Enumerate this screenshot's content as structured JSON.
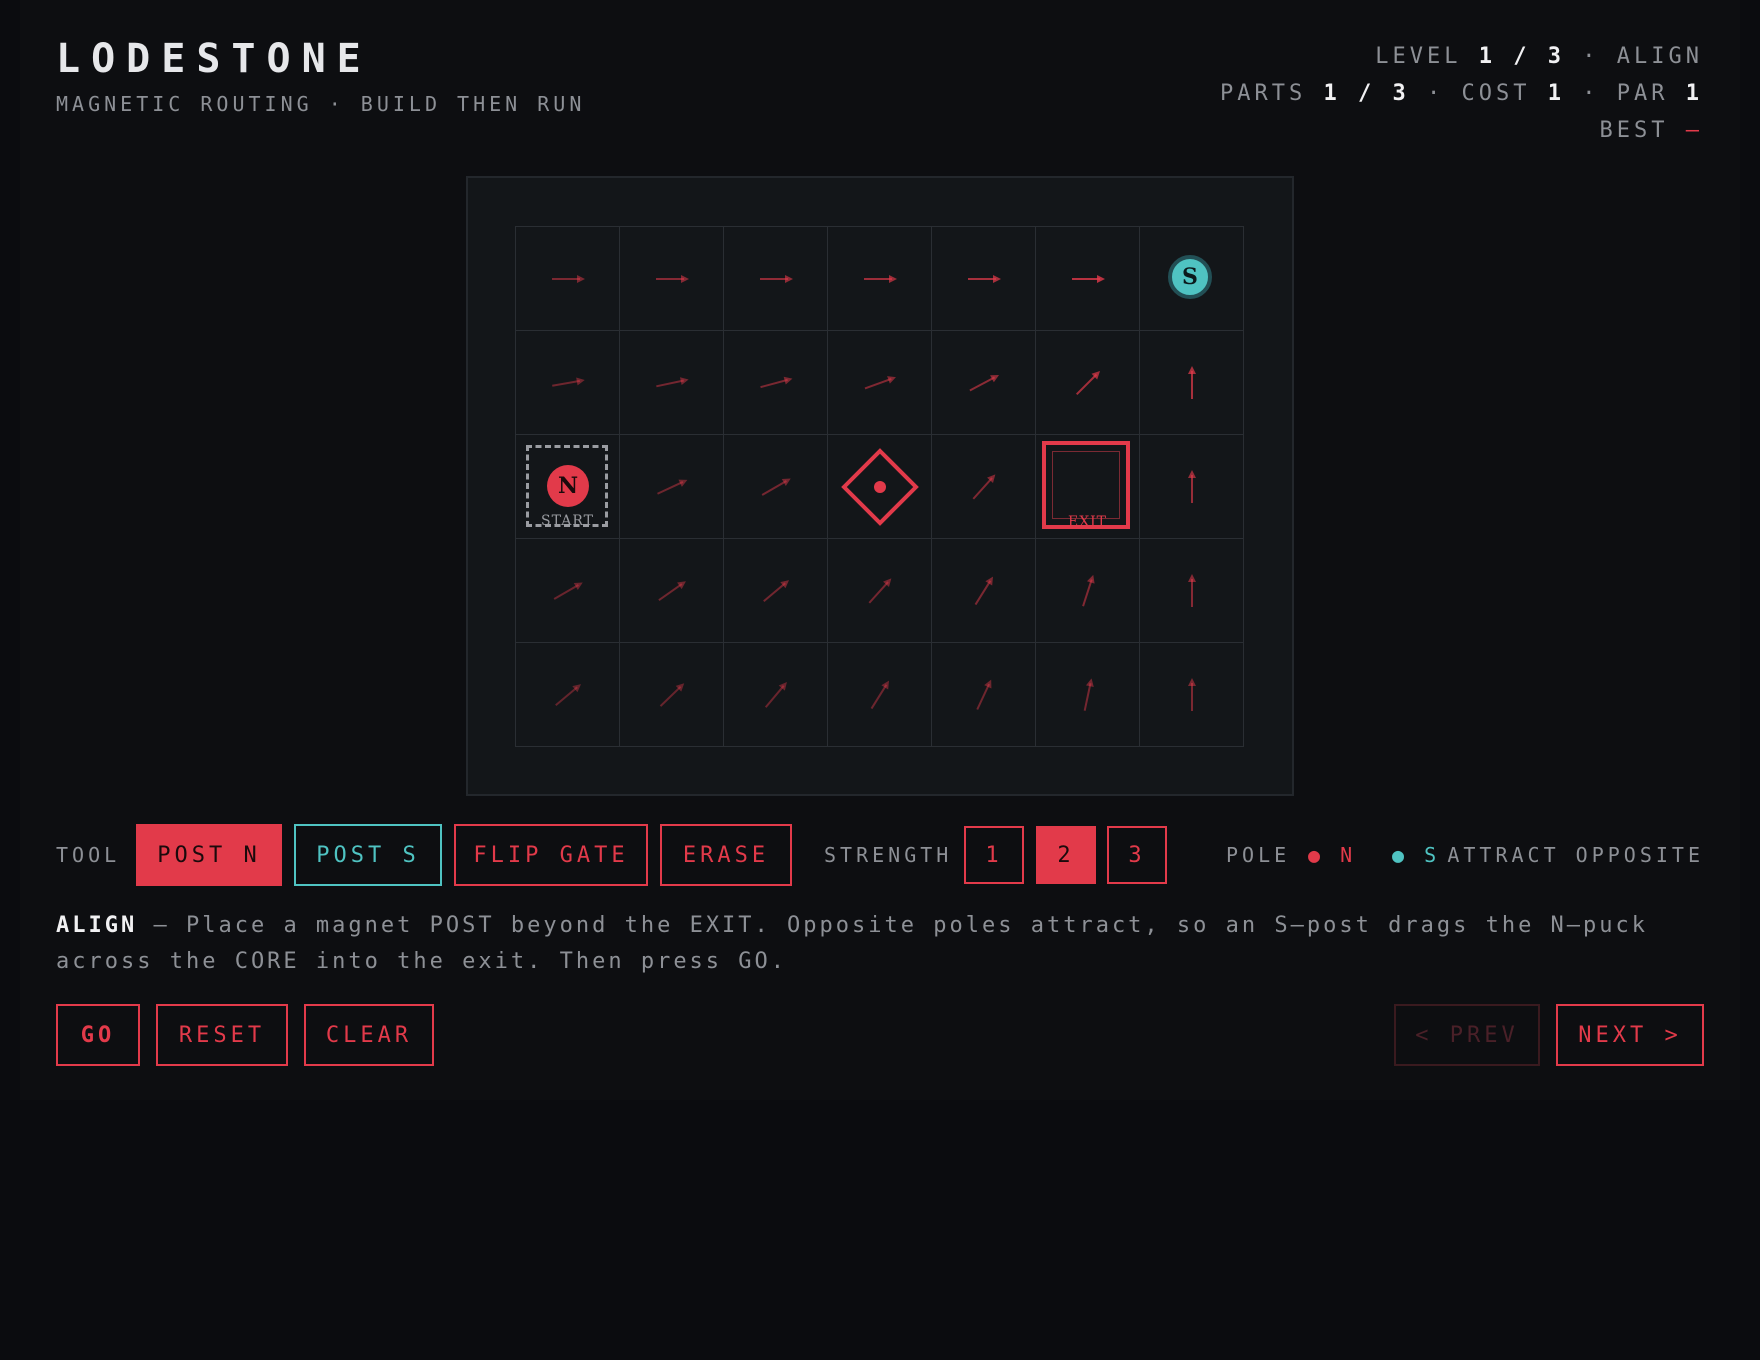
{
  "header": {
    "title": "LODESTONE",
    "subtitle": "MAGNETIC ROUTING · BUILD THEN RUN",
    "level_label": "LEVEL",
    "level_value": "1 / 3",
    "level_name": "ALIGN",
    "parts_label": "PARTS",
    "parts_value": "1 / 3",
    "cost_label": "COST",
    "cost_value": "1",
    "par_label": "PAR",
    "par_value": "1",
    "best_label": "BEST",
    "best_value": "—"
  },
  "board": {
    "cols": 7,
    "rows": 5,
    "start_label": "START",
    "exit_label": "EXIT",
    "puck_letter": "N",
    "post_letter": "S",
    "field_arrows_deg": [
      [
        0,
        0,
        0,
        0,
        0,
        0,
        null
      ],
      [
        -10,
        -12,
        -15,
        -20,
        -28,
        -45,
        -90
      ],
      [
        null,
        -25,
        -30,
        null,
        -48,
        null,
        -90
      ],
      [
        -30,
        -35,
        -40,
        -48,
        -58,
        -72,
        -90
      ],
      [
        -40,
        -44,
        -50,
        -58,
        -65,
        -78,
        -90
      ]
    ],
    "field_strength": [
      [
        0.45,
        0.55,
        0.65,
        0.75,
        0.85,
        1.0,
        null
      ],
      [
        0.35,
        0.4,
        0.45,
        0.5,
        0.6,
        0.8,
        0.85
      ],
      [
        null,
        0.35,
        0.4,
        null,
        0.5,
        null,
        0.7
      ],
      [
        0.3,
        0.35,
        0.38,
        0.4,
        0.45,
        0.5,
        0.55
      ],
      [
        0.25,
        0.28,
        0.3,
        0.33,
        0.36,
        0.4,
        0.45
      ]
    ]
  },
  "toolbar": {
    "tool_label": "TOOL",
    "post_n": "POST N",
    "post_s": "POST S",
    "flip_gate": "FLIP GATE",
    "erase": "ERASE",
    "strength_label": "STRENGTH",
    "strength_options": [
      "1",
      "2",
      "3"
    ],
    "strength_selected": "2",
    "pole_label": "POLE",
    "pole_n": "N",
    "pole_s": "S",
    "rule": "ATTRACT OPPOSITE"
  },
  "description": {
    "level_name": "ALIGN",
    "text": " — Place a magnet POST beyond the EXIT. Opposite poles attract, so an S–post drags the N–puck across the CORE into the exit. Then press GO."
  },
  "actions": {
    "go": "GO",
    "reset": "RESET",
    "clear": "CLEAR",
    "prev": "< PREV",
    "next": "NEXT >"
  },
  "colors": {
    "accent": "#e23a4a",
    "teal": "#4fc3c2",
    "background": "#0b0c0f"
  }
}
